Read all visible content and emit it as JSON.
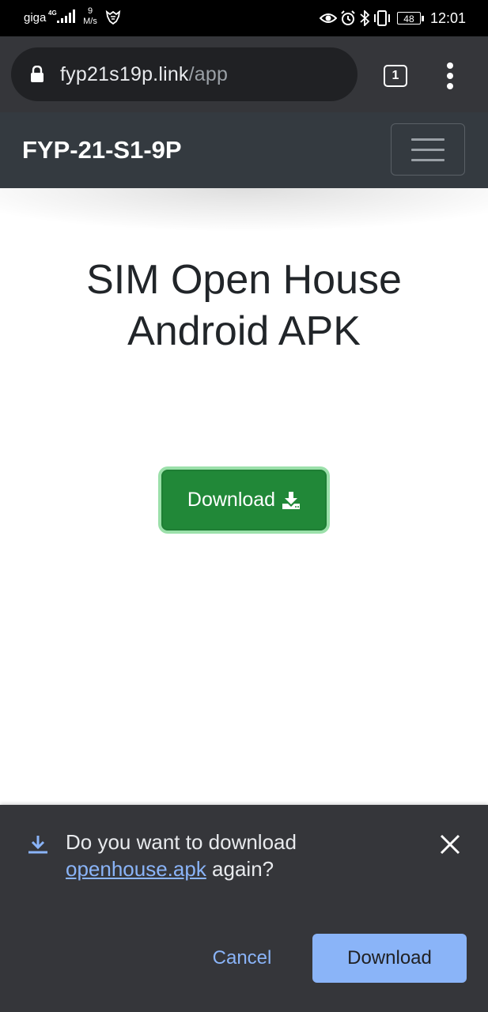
{
  "status_bar": {
    "carrier": "giga",
    "network": "4G",
    "speed_value": "9",
    "speed_unit": "M/s",
    "battery": "48",
    "time": "12:01"
  },
  "browser": {
    "url_host": "fyp21s19p.link",
    "url_path": "/app",
    "tab_count": "1"
  },
  "site": {
    "brand": "FYP-21-S1-9P",
    "title": "SIM Open House Android APK",
    "download_button": "Download"
  },
  "download_prompt": {
    "message_before": "Do you want to download",
    "filename": "openhouse.apk",
    "message_after": " again?",
    "cancel": "Cancel",
    "download": "Download"
  },
  "colors": {
    "status_bar": "#000000",
    "browser_toolbar": "#35363a",
    "navbar": "#343a40",
    "success_button": "#218838",
    "link_blue": "#8ab4f8"
  }
}
